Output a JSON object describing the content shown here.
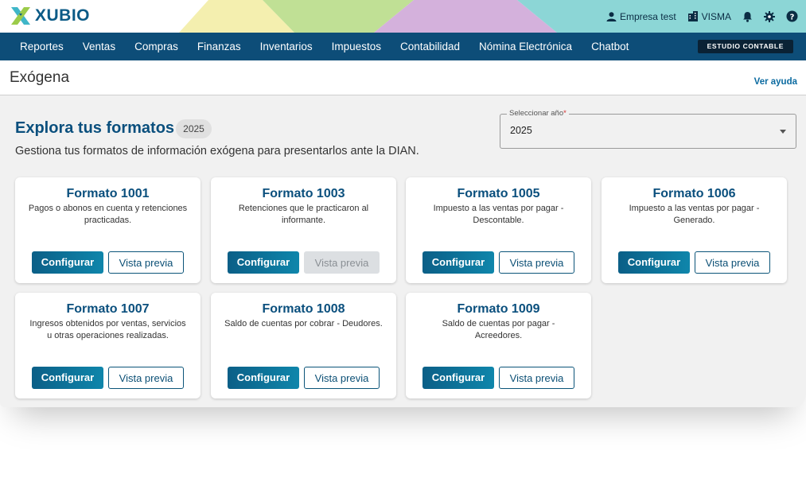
{
  "brand": {
    "name": "XUBIO"
  },
  "topbar": {
    "company": "Empresa test",
    "partner": "VISMA"
  },
  "nav": {
    "items": [
      "Reportes",
      "Ventas",
      "Compras",
      "Finanzas",
      "Inventarios",
      "Impuestos",
      "Contabilidad",
      "Nómina Electrónica",
      "Chatbot"
    ],
    "studio_button": "ESTUDIO CONTABLE"
  },
  "page": {
    "title": "Exógena",
    "help_link": "Ver ayuda"
  },
  "section": {
    "title": "Explora tus formatos",
    "year_badge": "2025",
    "subtitle": "Gestiona tus formatos de información exógena para presentarlos ante la DIAN."
  },
  "year_select": {
    "label": "Seleccionar año",
    "required_mark": "*",
    "value": "2025"
  },
  "cards": [
    {
      "title": "Formato 1001",
      "description": "Pagos o abonos en cuenta y retenciones practicadas.",
      "configure_label": "Configurar",
      "preview_label": "Vista previa",
      "preview_enabled": true
    },
    {
      "title": "Formato 1003",
      "description": "Retenciones que le practicaron al informante.",
      "configure_label": "Configurar",
      "preview_label": "Vista previa",
      "preview_enabled": false
    },
    {
      "title": "Formato 1005",
      "description": "Impuesto a las ventas por pagar - Descontable.",
      "configure_label": "Configurar",
      "preview_label": "Vista previa",
      "preview_enabled": true
    },
    {
      "title": "Formato 1006",
      "description": "Impuesto a las ventas por pagar - Generado.",
      "configure_label": "Configurar",
      "preview_label": "Vista previa",
      "preview_enabled": true
    },
    {
      "title": "Formato 1007",
      "description": "Ingresos obtenidos por ventas, servicios u otras operaciones realizadas.",
      "configure_label": "Configurar",
      "preview_label": "Vista previa",
      "preview_enabled": true
    },
    {
      "title": "Formato 1008",
      "description": "Saldo de cuentas por cobrar - Deudores.",
      "configure_label": "Configurar",
      "preview_label": "Vista previa",
      "preview_enabled": true
    },
    {
      "title": "Formato 1009",
      "description": "Saldo de cuentas por pagar - Acreedores.",
      "configure_label": "Configurar",
      "preview_label": "Vista previa",
      "preview_enabled": true
    }
  ],
  "colors": {
    "primary": "#0d4d78",
    "accent": "#0f86ab",
    "title": "#0a4f7d",
    "studio": "#0a2235"
  },
  "icons": [
    "user-icon",
    "building-icon",
    "bell-icon",
    "gear-icon",
    "help-icon",
    "chevron-down-icon"
  ]
}
